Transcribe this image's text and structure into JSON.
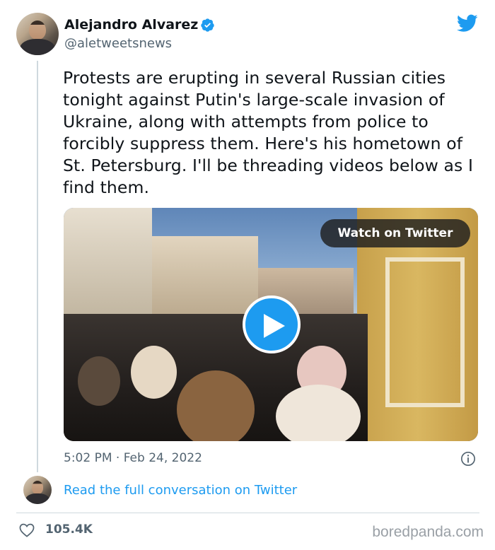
{
  "author": {
    "name": "Alejandro Alvarez",
    "handle": "@aletweetsnews",
    "verified": true
  },
  "tweet": {
    "text": "Protests are erupting in several Russian cities tonight against Putin's large-scale invasion of Ukraine, along with attempts from police to forcibly suppress them. Here's his hometown of St. Petersburg. I'll be threading videos below as I find them.",
    "timestamp": "5:02 PM · Feb 24, 2022",
    "media": {
      "watch_label": "Watch on Twitter",
      "type": "video"
    },
    "read_more": "Read the full conversation on Twitter",
    "likes": "105.4K"
  },
  "watermark": "boredpanda.com",
  "colors": {
    "accent": "#1d9bf0",
    "text": "#0f1419",
    "secondary": "#536471"
  },
  "icons": [
    "verified-badge-icon",
    "twitter-bird-icon",
    "play-icon",
    "info-icon",
    "heart-icon"
  ]
}
